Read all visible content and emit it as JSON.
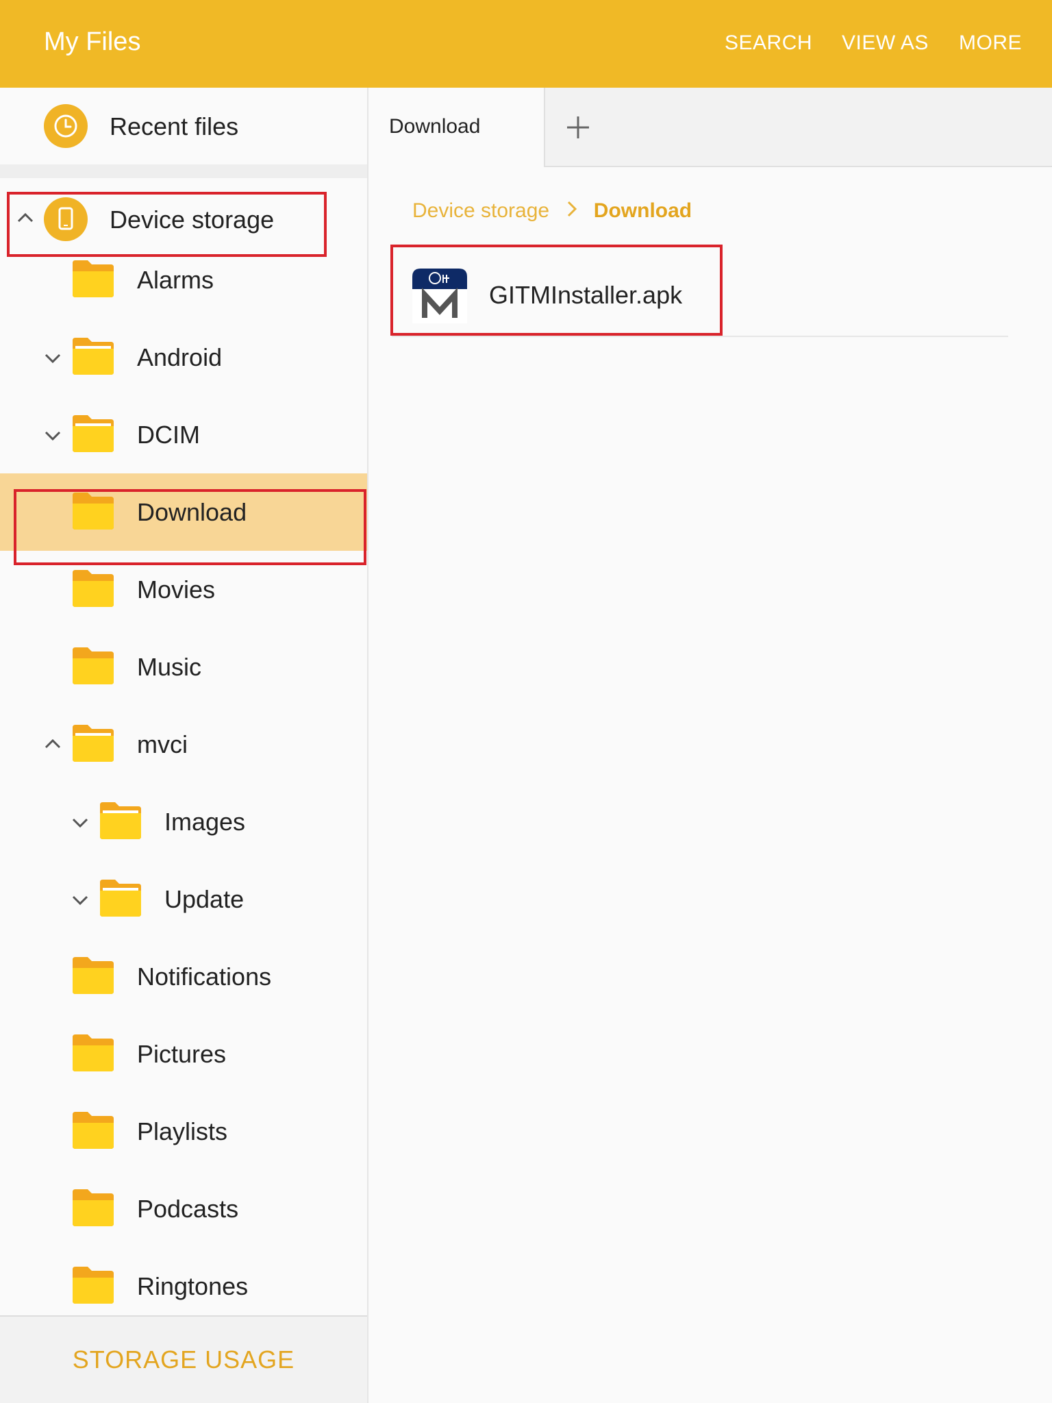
{
  "appbar": {
    "title": "My Files",
    "actions": {
      "search": "SEARCH",
      "view_as": "VIEW AS",
      "more": "MORE"
    }
  },
  "sidebar": {
    "recent_label": "Recent files",
    "device_storage_label": "Device storage",
    "folders": [
      {
        "label": "Alarms",
        "chevron": "none"
      },
      {
        "label": "Android",
        "chevron": "down"
      },
      {
        "label": "DCIM",
        "chevron": "down"
      },
      {
        "label": "Download",
        "chevron": "none",
        "selected": true
      },
      {
        "label": "Movies",
        "chevron": "none"
      },
      {
        "label": "Music",
        "chevron": "none"
      },
      {
        "label": "mvci",
        "chevron": "up"
      },
      {
        "label": "Images",
        "chevron": "down",
        "nested": true
      },
      {
        "label": "Update",
        "chevron": "down",
        "nested": true
      },
      {
        "label": "Notifications",
        "chevron": "none"
      },
      {
        "label": "Pictures",
        "chevron": "none"
      },
      {
        "label": "Playlists",
        "chevron": "none"
      },
      {
        "label": "Podcasts",
        "chevron": "none"
      },
      {
        "label": "Ringtones",
        "chevron": "none"
      }
    ],
    "storage_usage": "STORAGE USAGE"
  },
  "tabs": {
    "active": "Download",
    "add_icon": "plus-icon"
  },
  "breadcrumb": {
    "root": "Device storage",
    "current": "Download"
  },
  "files": [
    {
      "name": "GITMInstaller.apk",
      "icon": "gitm-app-icon"
    }
  ],
  "colors": {
    "accent": "#f0b926",
    "selected_row": "#f8d696",
    "highlight_box": "#d9232b",
    "breadcrumb_text": "#e3a51f"
  }
}
